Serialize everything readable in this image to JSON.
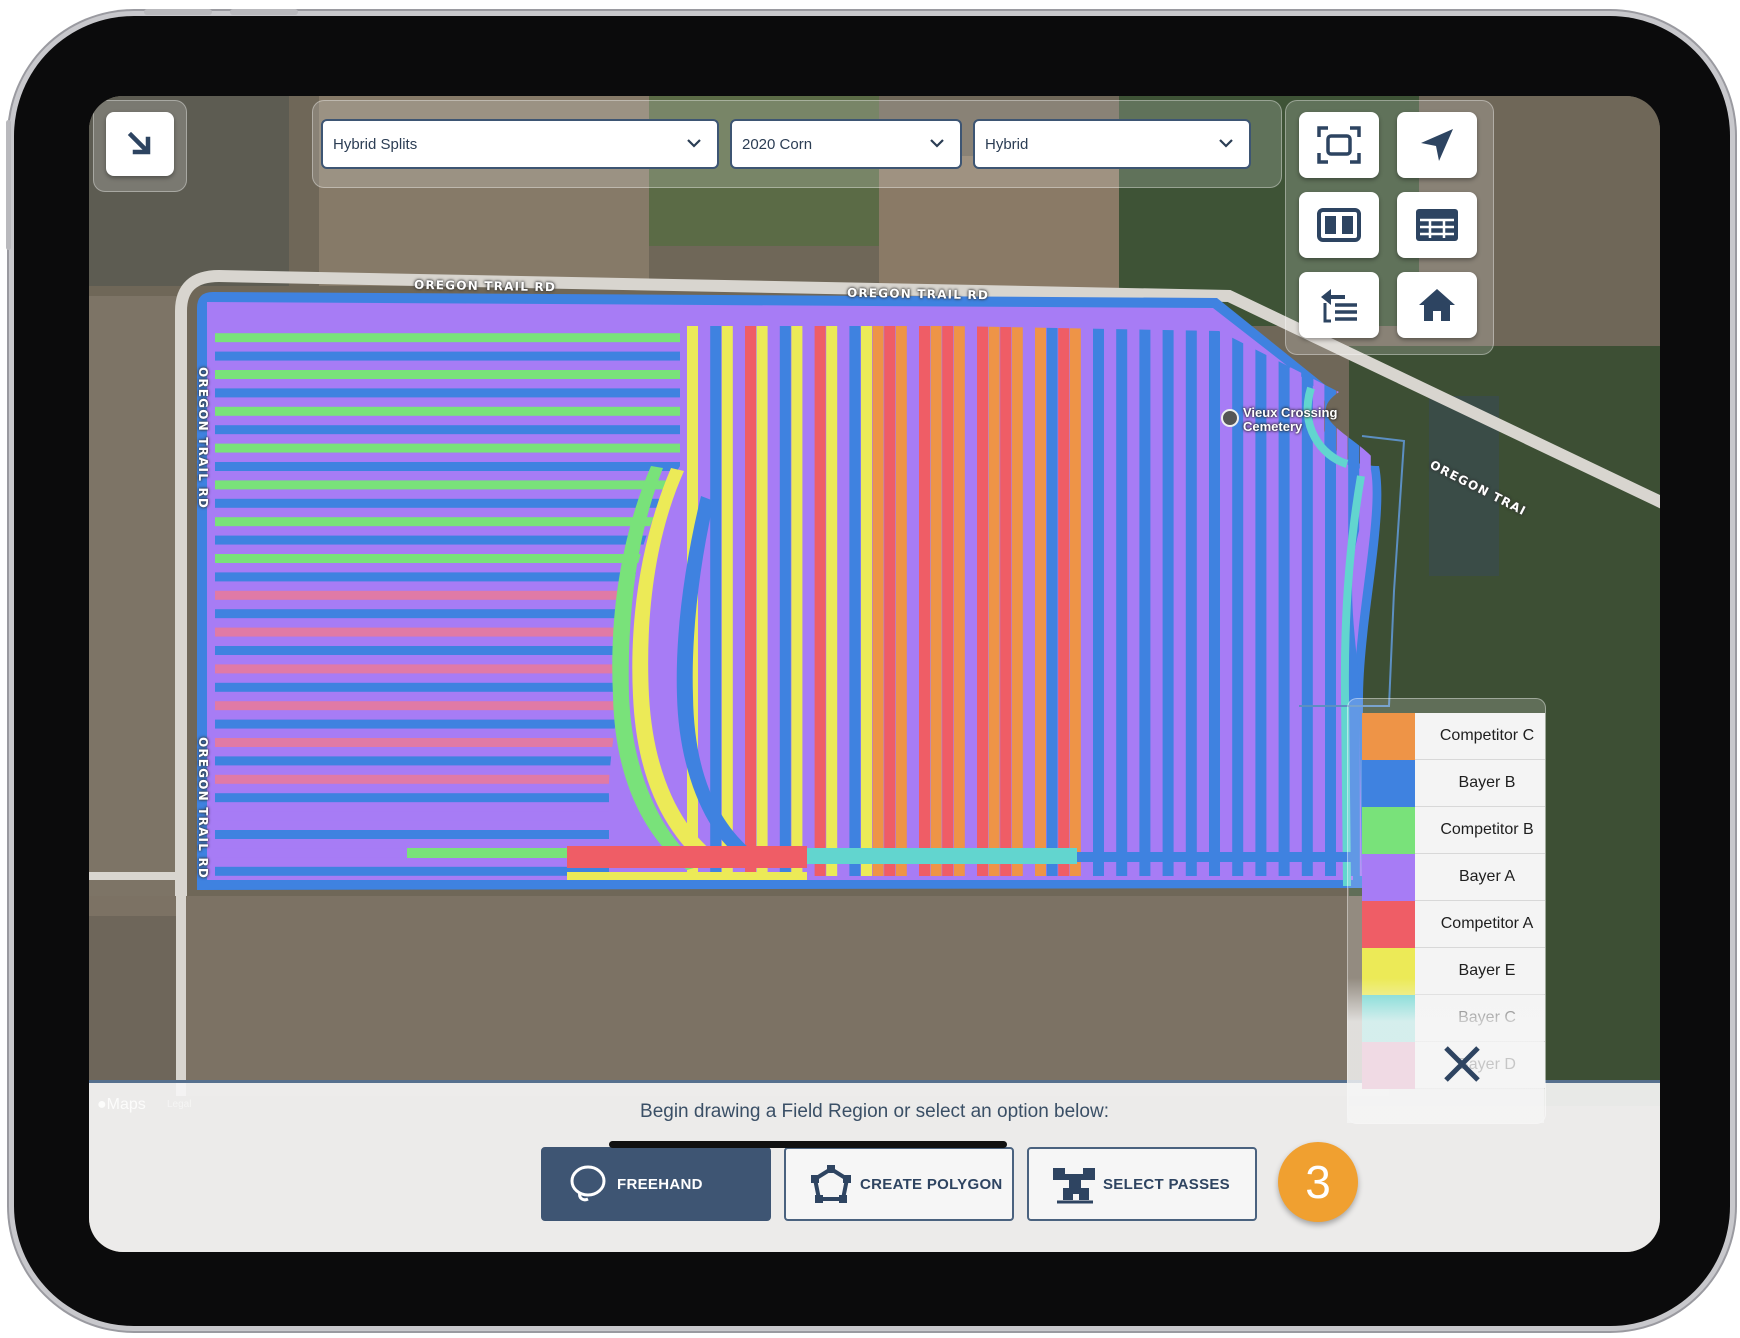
{
  "toolbar": {
    "collapse_icon": "arrow-down-right-icon",
    "dropdowns": [
      {
        "value": "Hybrid Splits"
      },
      {
        "value": "2020 Corn"
      },
      {
        "value": "Hybrid"
      }
    ]
  },
  "side_tools": [
    "fit-bounds-icon",
    "locate-icon",
    "split-view-icon",
    "table-icon",
    "import-layer-icon",
    "home-icon"
  ],
  "map": {
    "road_labels": [
      "OREGON TRAIL RD",
      "OREGON TRAIL RD",
      "OREGON TRAIL RD",
      "OREGON TRAIL RD",
      "OREGON TRAI"
    ],
    "poi": {
      "name_line1": "Vieux Crossing",
      "name_line2": "Cemetery"
    },
    "attribution": "Maps",
    "legal": "Legal",
    "colors": {
      "competitor_c": "#ee9447",
      "bayer_b": "#3f82e0",
      "competitor_b": "#79e27a",
      "bayer_a": "#a77cf5",
      "competitor_a": "#ef5d66",
      "bayer_e": "#ecea57",
      "bayer_c": "#62d5cf",
      "bayer_d": "#e07aa6"
    }
  },
  "legend": [
    {
      "label": "Competitor C",
      "color": "#ee9447"
    },
    {
      "label": "Bayer B",
      "color": "#3f82e0"
    },
    {
      "label": "Competitor B",
      "color": "#79e27a"
    },
    {
      "label": "Bayer A",
      "color": "#a77cf5"
    },
    {
      "label": "Competitor A",
      "color": "#ef5d66"
    },
    {
      "label": "Bayer E",
      "color": "#ecea57"
    },
    {
      "label": "Bayer C",
      "color": "#62d5cf"
    },
    {
      "label": "Bayer D",
      "color": "#e07aa6"
    }
  ],
  "bottom": {
    "prompt": "Begin drawing a Field Region or select an option below:",
    "buttons": [
      {
        "label": "FREEHAND",
        "icon": "lasso-icon",
        "active": true
      },
      {
        "label": "CREATE POLYGON",
        "icon": "polygon-icon",
        "active": false
      },
      {
        "label": "SELECT PASSES",
        "icon": "tractor-icon",
        "active": false
      }
    ],
    "step_badge": "3",
    "close_icon": "close-icon"
  }
}
